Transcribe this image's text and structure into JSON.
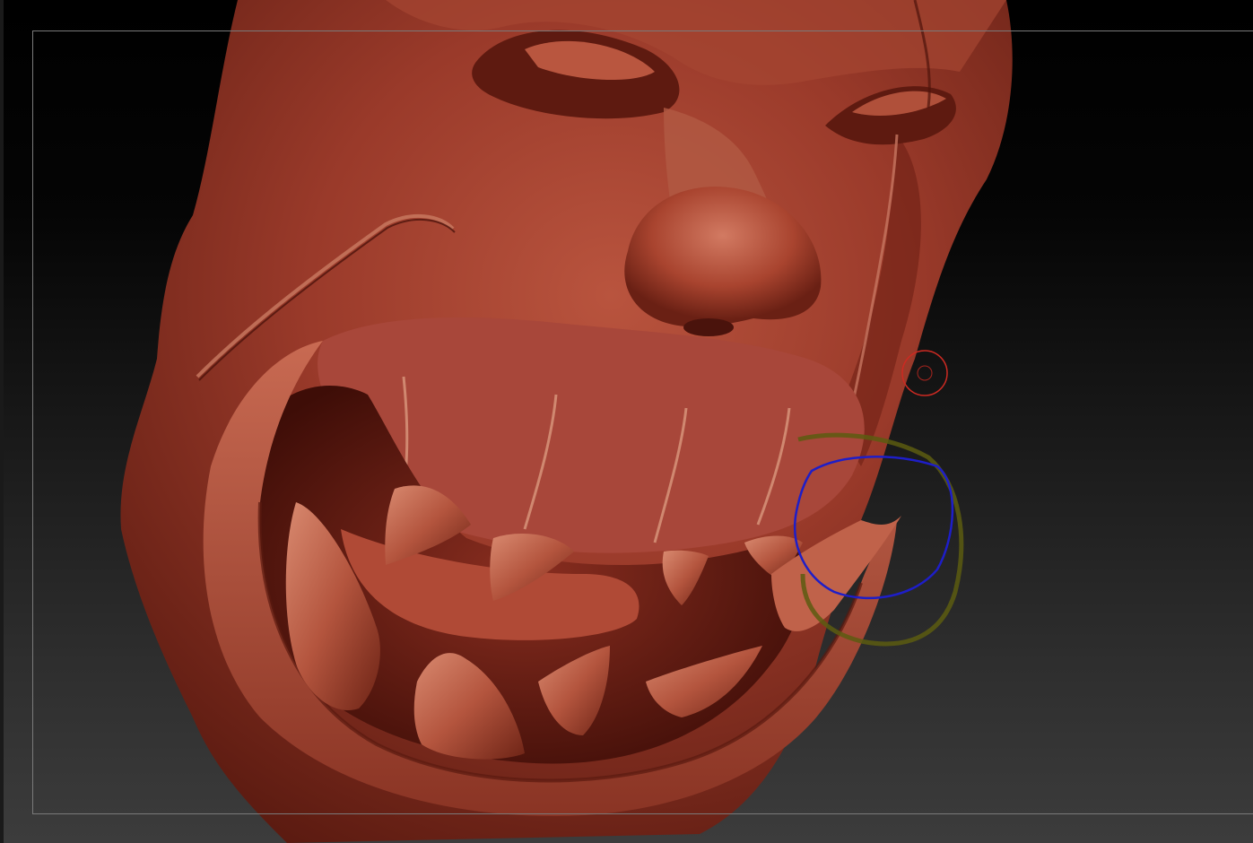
{
  "viewport": {
    "background_top": "#000000",
    "background_bottom": "#3c3c3c",
    "frame_color": "#7a7a7a"
  },
  "model": {
    "material_color": "#9a3a2a",
    "highlight_color": "#c96a55",
    "shadow_color": "#4a130c"
  },
  "cursor": {
    "focal_ring_color": "#cc2a22",
    "draw_ring_color": "#1a1acc",
    "lazy_ring_color": "#6a6a12"
  }
}
